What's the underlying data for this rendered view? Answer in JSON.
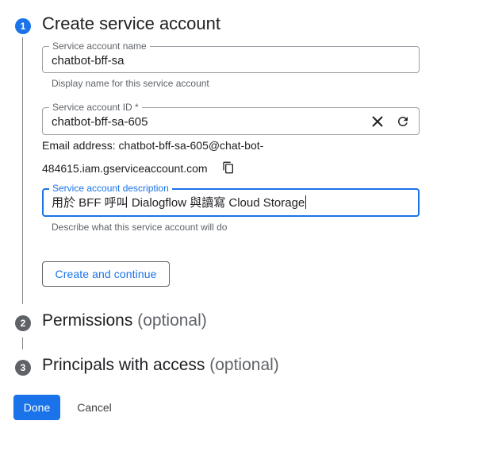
{
  "steps": [
    {
      "number": "1",
      "title": "Create service account",
      "optional": ""
    },
    {
      "number": "2",
      "title": "Permissions",
      "optional": "(optional)"
    },
    {
      "number": "3",
      "title": "Principals with access",
      "optional": "(optional)"
    }
  ],
  "form": {
    "name_field": {
      "label": "Service account name",
      "value": "chatbot-bff-sa",
      "hint": "Display name for this service account"
    },
    "id_field": {
      "label": "Service account ID *",
      "value": "chatbot-bff-sa-605"
    },
    "email": {
      "line1": "Email address: chatbot-bff-sa-605@chat-bot-",
      "line2": "484615.iam.gserviceaccount.com"
    },
    "description_field": {
      "label": "Service account description",
      "value": "用於 BFF 呼叫 Dialogflow 與讀寫 Cloud Storage",
      "hint": "Describe what this service account will do"
    },
    "create_button": "Create and continue"
  },
  "footer": {
    "done_button": "Done",
    "cancel_button": "Cancel"
  },
  "icons": {
    "clear": "close-icon",
    "refresh": "refresh-icon",
    "copy": "copy-icon"
  },
  "colors": {
    "accent": "#1a73e8",
    "inactive_step": "#5f6368"
  }
}
